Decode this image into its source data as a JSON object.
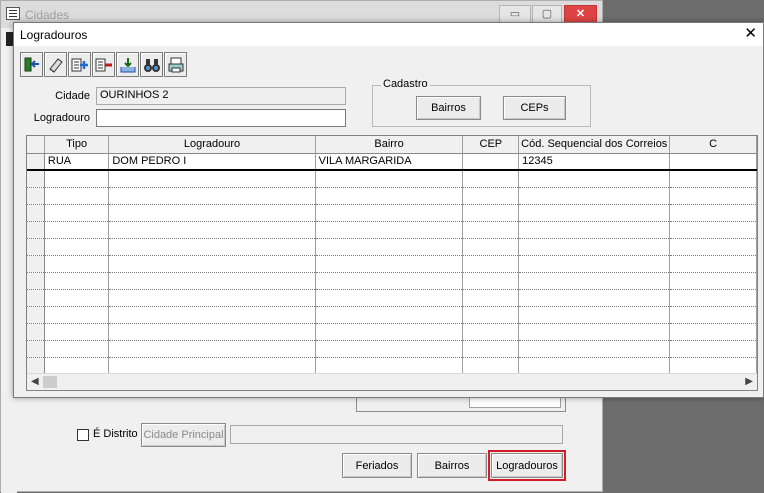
{
  "background_window": {
    "title": "Cidades",
    "minimize": "▭",
    "maximize": "▢",
    "close": "✕",
    "distrito_label": "É Distrito",
    "cidade_principal_label": "Cidade Principal",
    "buttons": {
      "feriados": "Feriados",
      "bairros": "Bairros",
      "logradouros": "Logradouros"
    }
  },
  "dialog": {
    "title": "Logradouros",
    "close": "✕",
    "toolbar": [
      {
        "icon": "exit-icon"
      },
      {
        "icon": "eraser-icon"
      },
      {
        "icon": "add-record-icon"
      },
      {
        "icon": "remove-record-icon"
      },
      {
        "icon": "import-icon"
      },
      {
        "icon": "binoculars-icon"
      },
      {
        "icon": "print-icon"
      }
    ],
    "cidade": {
      "label": "Cidade",
      "value": "OURINHOS 2"
    },
    "logradouro": {
      "label": "Logradouro",
      "value": ""
    },
    "cadastro": {
      "title": "Cadastro",
      "bairros": "Bairros",
      "ceps": "CEPs"
    },
    "grid": {
      "columns": [
        "Tipo",
        "Logradouro",
        "Bairro",
        "CEP",
        "Cód. Sequencial dos Correios",
        "C"
      ],
      "rows": [
        [
          "RUA",
          "DOM PEDRO I",
          "VILA MARGARIDA",
          "",
          "12345",
          ""
        ]
      ],
      "empty_rows": 12
    }
  },
  "colors": {
    "highlight": "#d11d2a",
    "close_red": "#e04343"
  }
}
